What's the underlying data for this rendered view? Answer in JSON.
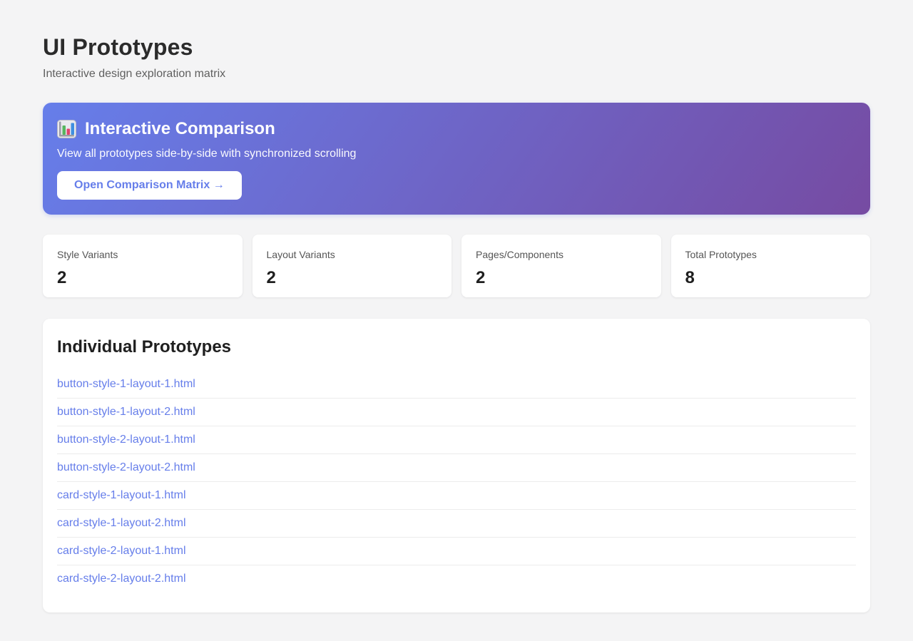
{
  "page": {
    "title": "UI Prototypes",
    "subtitle": "Interactive design exploration matrix"
  },
  "banner": {
    "icon": "bar-chart-emoji",
    "title": "Interactive Comparison",
    "description": "View all prototypes side-by-side with synchronized scrolling",
    "button_label": "Open Comparison Matrix →",
    "gradient_start": "#667eea",
    "gradient_end": "#764ba2"
  },
  "stats": [
    {
      "label": "Style Variants",
      "value": "2"
    },
    {
      "label": "Layout Variants",
      "value": "2"
    },
    {
      "label": "Pages/Components",
      "value": "2"
    },
    {
      "label": "Total Prototypes",
      "value": "8"
    }
  ],
  "prototypes": {
    "heading": "Individual Prototypes",
    "links": [
      "button-style-1-layout-1.html",
      "button-style-1-layout-2.html",
      "button-style-2-layout-1.html",
      "button-style-2-layout-2.html",
      "card-style-1-layout-1.html",
      "card-style-1-layout-2.html",
      "card-style-2-layout-1.html",
      "card-style-2-layout-2.html"
    ]
  },
  "colors": {
    "accent": "#667eea",
    "page_background": "#f4f4f5",
    "card_background": "#ffffff",
    "link": "#667eea"
  }
}
